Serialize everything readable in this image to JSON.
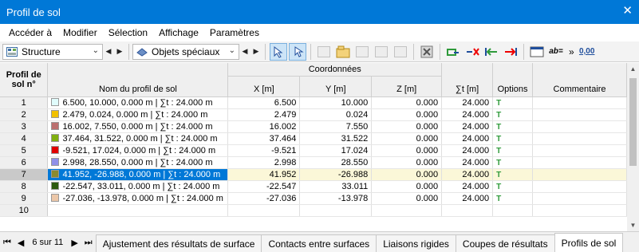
{
  "window": {
    "title": "Profil de sol"
  },
  "menu": [
    "Accéder à",
    "Modifier",
    "Sélection",
    "Affichage",
    "Paramètres"
  ],
  "toolbar": {
    "combo1": "Structure",
    "combo2": "Objets spéciaux",
    "more_label": "»",
    "ab_label": "ab=",
    "zero_label": "0,00"
  },
  "table": {
    "headers": {
      "rownum": "Profil de sol n°",
      "group": "Coordonnées",
      "name": "Nom du profil de sol",
      "x": "X [m]",
      "y": "Y [m]",
      "z": "Z [m]",
      "sum": "∑t [m]",
      "options": "Options",
      "comment": "Commentaire"
    },
    "rows": [
      {
        "n": "1",
        "color": "#e0fcfc",
        "name": "6.500, 10.000, 0.000 m | ∑t : 24.000 m",
        "x": "6.500",
        "y": "10.000",
        "z": "0.000",
        "t": "24.000",
        "opt": "T",
        "comment": ""
      },
      {
        "n": "2",
        "color": "#f2c100",
        "name": "2.479, 0.024, 0.000 m | ∑t : 24.000 m",
        "x": "2.479",
        "y": "0.024",
        "z": "0.000",
        "t": "24.000",
        "opt": "T",
        "comment": ""
      },
      {
        "n": "3",
        "color": "#bb7070",
        "name": "16.002, 7.550, 0.000 m | ∑t : 24.000 m",
        "x": "16.002",
        "y": "7.550",
        "z": "0.000",
        "t": "24.000",
        "opt": "T",
        "comment": ""
      },
      {
        "n": "4",
        "color": "#80b010",
        "name": "37.464, 31.522, 0.000 m | ∑t : 24.000 m",
        "x": "37.464",
        "y": "31.522",
        "z": "0.000",
        "t": "24.000",
        "opt": "T",
        "comment": ""
      },
      {
        "n": "5",
        "color": "#e00000",
        "name": "-9.521, 17.024, 0.000 m | ∑t : 24.000 m",
        "x": "-9.521",
        "y": "17.024",
        "z": "0.000",
        "t": "24.000",
        "opt": "T",
        "comment": ""
      },
      {
        "n": "6",
        "color": "#8f8fe8",
        "name": "2.998, 28.550, 0.000 m | ∑t : 24.000 m",
        "x": "2.998",
        "y": "28.550",
        "z": "0.000",
        "t": "24.000",
        "opt": "T",
        "comment": ""
      },
      {
        "n": "7",
        "color": "#8a8a30",
        "name": "41.952, -26.988, 0.000 m | ∑t : 24.000 m",
        "x": "41.952",
        "y": "-26.988",
        "z": "0.000",
        "t": "24.000",
        "opt": "T",
        "comment": "",
        "selected": true
      },
      {
        "n": "8",
        "color": "#2c5a10",
        "name": "-22.547, 33.011, 0.000 m | ∑t : 24.000 m",
        "x": "-22.547",
        "y": "33.011",
        "z": "0.000",
        "t": "24.000",
        "opt": "T",
        "comment": ""
      },
      {
        "n": "9",
        "color": "#ecc7a8",
        "name": "-27.036, -13.978, 0.000 m | ∑t : 24.000 m",
        "x": "-27.036",
        "y": "-13.978",
        "z": "0.000",
        "t": "24.000",
        "opt": "T",
        "comment": ""
      },
      {
        "n": "10",
        "color": "",
        "name": "",
        "x": "",
        "y": "",
        "z": "",
        "t": "",
        "opt": "",
        "comment": ""
      }
    ]
  },
  "tabs": {
    "page_info": "6 sur 11",
    "items": [
      "Ajustement des résultats de surface",
      "Contacts entre surfaces",
      "Liaisons rigides",
      "Coupes de résultats",
      "Profils de sol"
    ],
    "active_index": 4
  }
}
